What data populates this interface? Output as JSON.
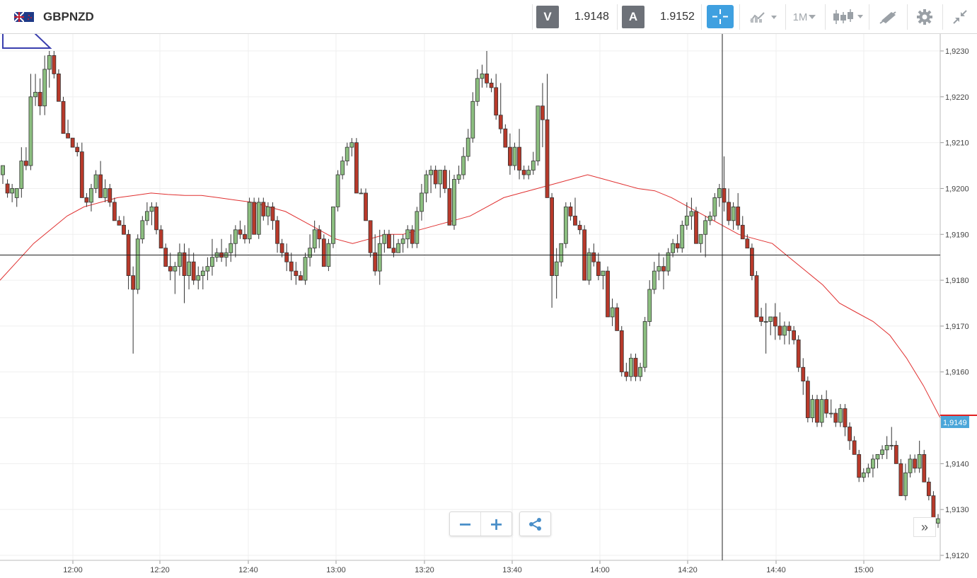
{
  "header": {
    "symbol": "GBPNZD",
    "bid_label": "V",
    "bid_value": "1.9148",
    "ask_label": "A",
    "ask_value": "1.9152",
    "timeframe": "1M",
    "icons": [
      "flag-gbp-nzd-icon",
      "crosshair-icon",
      "chart-type-icon",
      "timeframe-dropdown",
      "candlestick-icon",
      "draw-tool-icon",
      "settings-gear-icon",
      "collapse-arrows-icon"
    ]
  },
  "controls": {
    "zoom_out": "−",
    "zoom_in": "+",
    "share_icon": "share-icon",
    "scroll_right": "»"
  },
  "chart_data": {
    "type": "candlestick",
    "y_ticks": [
      "1,9230",
      "1,9220",
      "1,9210",
      "1,9200",
      "1,9190",
      "1,9180",
      "1,9170",
      "1,9160",
      "1,9150",
      "1,9140",
      "1,9130",
      "1,9120"
    ],
    "x_ticks": [
      "12:00",
      "12:20",
      "12:40",
      "13:00",
      "13:20",
      "13:40",
      "14:00",
      "14:20",
      "14:40",
      "15:00"
    ],
    "ylim": [
      1.9118,
      1.9233
    ],
    "current_price_label": "1,9149",
    "current_price": 1.9149,
    "horizontal_line": 1.91855,
    "moving_average_color": "#e03030",
    "up_color": "#8cbf80",
    "down_color": "#b8392a",
    "moving_average": [
      1.918,
      1.9184,
      1.9188,
      1.9191,
      1.9194,
      1.9196,
      1.9197,
      1.9198,
      1.91985,
      1.9199,
      1.91987,
      1.91985,
      1.91985,
      1.9198,
      1.91975,
      1.9197,
      1.9196,
      1.9195,
      1.9193,
      1.9191,
      1.9189,
      1.9188,
      1.9189,
      1.919,
      1.919,
      1.9191,
      1.9192,
      1.9193,
      1.9194,
      1.9196,
      1.9198,
      1.9199,
      1.92,
      1.9201,
      1.9202,
      1.9203,
      1.9202,
      1.9201,
      1.92,
      1.91995,
      1.9198,
      1.9196,
      1.9194,
      1.9192,
      1.919,
      1.9189,
      1.9188,
      1.9185,
      1.9182,
      1.9179,
      1.9175,
      1.9173,
      1.9171,
      1.9168,
      1.9163,
      1.9157,
      1.915
    ],
    "candles": [
      [
        1.9203,
        1.9205,
        1.9201,
        1.9205
      ],
      [
        1.9201,
        1.9202,
        1.9198,
        1.9199
      ],
      [
        1.9199,
        1.9201,
        1.9197,
        1.92
      ],
      [
        1.9198,
        1.92,
        1.9196,
        1.92
      ],
      [
        1.92,
        1.9209,
        1.9198,
        1.9206
      ],
      [
        1.9206,
        1.9209,
        1.9204,
        1.9205
      ],
      [
        1.9205,
        1.9225,
        1.9204,
        1.922
      ],
      [
        1.922,
        1.9225,
        1.9218,
        1.9221
      ],
      [
        1.9221,
        1.9224,
        1.9216,
        1.9218
      ],
      [
        1.9218,
        1.9229,
        1.9216,
        1.9226
      ],
      [
        1.9226,
        1.923,
        1.9222,
        1.9229
      ],
      [
        1.9229,
        1.923,
        1.9224,
        1.9225
      ],
      [
        1.9225,
        1.9226,
        1.9219,
        1.9219
      ],
      [
        1.9219,
        1.922,
        1.9212,
        1.9212
      ],
      [
        1.9212,
        1.9215,
        1.9211,
        1.9211
      ],
      [
        1.9211,
        1.9211,
        1.9209,
        1.9209
      ],
      [
        1.9209,
        1.921,
        1.9207,
        1.9208
      ],
      [
        1.9208,
        1.921,
        1.9198,
        1.9198
      ],
      [
        1.9198,
        1.9199,
        1.9196,
        1.9197
      ],
      [
        1.9197,
        1.9201,
        1.9195,
        1.92
      ],
      [
        1.92,
        1.9204,
        1.9199,
        1.9203
      ],
      [
        1.9203,
        1.9206,
        1.9198,
        1.9198
      ],
      [
        1.9198,
        1.9202,
        1.9197,
        1.92
      ],
      [
        1.92,
        1.9201,
        1.9196,
        1.9197
      ],
      [
        1.9197,
        1.9198,
        1.9193,
        1.9193
      ],
      [
        1.9193,
        1.9194,
        1.9192,
        1.9192
      ],
      [
        1.9192,
        1.9194,
        1.919,
        1.919
      ],
      [
        1.919,
        1.9191,
        1.9178,
        1.9181
      ],
      [
        1.9181,
        1.9183,
        1.9164,
        1.9178
      ],
      [
        1.9178,
        1.919,
        1.9177,
        1.9189
      ],
      [
        1.9189,
        1.9194,
        1.9188,
        1.9193
      ],
      [
        1.9193,
        1.9197,
        1.9192,
        1.9195
      ],
      [
        1.9195,
        1.9197,
        1.9192,
        1.9196
      ],
      [
        1.9196,
        1.9197,
        1.919,
        1.9191
      ],
      [
        1.9191,
        1.9192,
        1.9187,
        1.9187
      ],
      [
        1.9187,
        1.9188,
        1.9183,
        1.9183
      ],
      [
        1.9183,
        1.9186,
        1.918,
        1.9182
      ],
      [
        1.9182,
        1.9184,
        1.9177,
        1.9183
      ],
      [
        1.9183,
        1.9188,
        1.9181,
        1.9186
      ],
      [
        1.9186,
        1.9188,
        1.9175,
        1.9181
      ],
      [
        1.9181,
        1.9187,
        1.9178,
        1.9184
      ],
      [
        1.9184,
        1.9186,
        1.9179,
        1.918
      ],
      [
        1.918,
        1.9183,
        1.9178,
        1.9181
      ],
      [
        1.9181,
        1.9183,
        1.9178,
        1.9182
      ],
      [
        1.9182,
        1.9185,
        1.918,
        1.9183
      ],
      [
        1.9183,
        1.9189,
        1.9181,
        1.9185
      ],
      [
        1.9185,
        1.9187,
        1.9184,
        1.9186
      ],
      [
        1.9186,
        1.9189,
        1.9184,
        1.9185
      ],
      [
        1.9185,
        1.9187,
        1.9183,
        1.9186
      ],
      [
        1.9186,
        1.919,
        1.9184,
        1.9188
      ],
      [
        1.9188,
        1.9192,
        1.9185,
        1.9191
      ],
      [
        1.9191,
        1.9193,
        1.9189,
        1.919
      ],
      [
        1.919,
        1.9192,
        1.9188,
        1.9189
      ],
      [
        1.9189,
        1.9198,
        1.9188,
        1.9197
      ],
      [
        1.9197,
        1.9198,
        1.919,
        1.919
      ],
      [
        1.919,
        1.9198,
        1.9189,
        1.9197
      ],
      [
        1.9197,
        1.9198,
        1.9193,
        1.9194
      ],
      [
        1.9194,
        1.9197,
        1.9192,
        1.9196
      ],
      [
        1.9196,
        1.9197,
        1.9191,
        1.9193
      ],
      [
        1.9193,
        1.9194,
        1.9186,
        1.9188
      ],
      [
        1.9188,
        1.9189,
        1.9185,
        1.9186
      ],
      [
        1.9186,
        1.9188,
        1.9182,
        1.9184
      ],
      [
        1.9184,
        1.9186,
        1.918,
        1.9182
      ],
      [
        1.9182,
        1.9184,
        1.9179,
        1.9181
      ],
      [
        1.9181,
        1.9182,
        1.918,
        1.918
      ],
      [
        1.918,
        1.9186,
        1.9179,
        1.9185
      ],
      [
        1.9185,
        1.919,
        1.9183,
        1.9187
      ],
      [
        1.9187,
        1.9193,
        1.9186,
        1.9191
      ],
      [
        1.9191,
        1.9192,
        1.9187,
        1.9189
      ],
      [
        1.9189,
        1.919,
        1.9183,
        1.9183
      ],
      [
        1.9183,
        1.9189,
        1.9182,
        1.9188
      ],
      [
        1.9188,
        1.9196,
        1.9187,
        1.9196
      ],
      [
        1.9196,
        1.9204,
        1.9195,
        1.9203
      ],
      [
        1.9203,
        1.9207,
        1.9202,
        1.9206
      ],
      [
        1.9206,
        1.921,
        1.9205,
        1.9209
      ],
      [
        1.9209,
        1.9211,
        1.9207,
        1.921
      ],
      [
        1.921,
        1.9211,
        1.9199,
        1.9199
      ],
      [
        1.9199,
        1.92,
        1.9199,
        1.9199
      ],
      [
        1.9199,
        1.92,
        1.9193,
        1.9193
      ],
      [
        1.9193,
        1.9193,
        1.9185,
        1.9186
      ],
      [
        1.9186,
        1.919,
        1.9181,
        1.9182
      ],
      [
        1.9182,
        1.9191,
        1.9179,
        1.9188
      ],
      [
        1.9188,
        1.9191,
        1.9186,
        1.919
      ],
      [
        1.919,
        1.9191,
        1.9187,
        1.9187
      ],
      [
        1.9187,
        1.919,
        1.9185,
        1.9186
      ],
      [
        1.9186,
        1.9189,
        1.9186,
        1.9188
      ],
      [
        1.9188,
        1.919,
        1.9186,
        1.9189
      ],
      [
        1.9189,
        1.9192,
        1.9187,
        1.9191
      ],
      [
        1.9191,
        1.9192,
        1.9187,
        1.9188
      ],
      [
        1.9188,
        1.9196,
        1.9187,
        1.9195
      ],
      [
        1.9195,
        1.9201,
        1.9193,
        1.9199
      ],
      [
        1.9199,
        1.9204,
        1.9197,
        1.9203
      ],
      [
        1.9203,
        1.9205,
        1.9199,
        1.9204
      ],
      [
        1.9204,
        1.9205,
        1.92,
        1.9201
      ],
      [
        1.9201,
        1.9204,
        1.9198,
        1.9204
      ],
      [
        1.9204,
        1.9205,
        1.9199,
        1.92
      ],
      [
        1.92,
        1.9204,
        1.9192,
        1.9192
      ],
      [
        1.9192,
        1.9203,
        1.9191,
        1.9202
      ],
      [
        1.9202,
        1.9205,
        1.9201,
        1.9203
      ],
      [
        1.9203,
        1.9209,
        1.9202,
        1.9207
      ],
      [
        1.9207,
        1.9213,
        1.9206,
        1.9211
      ],
      [
        1.9211,
        1.9221,
        1.921,
        1.9219
      ],
      [
        1.9219,
        1.9226,
        1.9218,
        1.9224
      ],
      [
        1.9224,
        1.9227,
        1.9222,
        1.9225
      ],
      [
        1.9225,
        1.923,
        1.9222,
        1.9223
      ],
      [
        1.9223,
        1.9224,
        1.9221,
        1.9222
      ],
      [
        1.9222,
        1.9225,
        1.9215,
        1.9216
      ],
      [
        1.9216,
        1.9223,
        1.9212,
        1.9213
      ],
      [
        1.9213,
        1.9214,
        1.9209,
        1.9209
      ],
      [
        1.9209,
        1.9212,
        1.9203,
        1.9205
      ],
      [
        1.9205,
        1.921,
        1.9204,
        1.9209
      ],
      [
        1.9209,
        1.9213,
        1.9202,
        1.9204
      ],
      [
        1.9204,
        1.9205,
        1.9202,
        1.9203
      ],
      [
        1.9203,
        1.9205,
        1.9202,
        1.9204
      ],
      [
        1.9204,
        1.9208,
        1.9203,
        1.9206
      ],
      [
        1.9206,
        1.9218,
        1.9205,
        1.9218
      ],
      [
        1.9218,
        1.9223,
        1.9209,
        1.9215
      ],
      [
        1.9215,
        1.9225,
        1.9198,
        1.9198
      ],
      [
        1.9198,
        1.9199,
        1.9174,
        1.9181
      ],
      [
        1.9181,
        1.9187,
        1.9176,
        1.9184
      ],
      [
        1.9184,
        1.9188,
        1.9183,
        1.9188
      ],
      [
        1.9188,
        1.9197,
        1.9187,
        1.9196
      ],
      [
        1.9196,
        1.9197,
        1.9193,
        1.9194
      ],
      [
        1.9194,
        1.9198,
        1.9192,
        1.9192
      ],
      [
        1.9192,
        1.9193,
        1.919,
        1.9191
      ],
      [
        1.9191,
        1.9192,
        1.918,
        1.918
      ],
      [
        1.918,
        1.9187,
        1.9179,
        1.9186
      ],
      [
        1.9186,
        1.9188,
        1.9183,
        1.9184
      ],
      [
        1.9184,
        1.9186,
        1.918,
        1.9181
      ],
      [
        1.9181,
        1.9182,
        1.9178,
        1.9182
      ],
      [
        1.9182,
        1.9183,
        1.9172,
        1.9172
      ],
      [
        1.9172,
        1.9176,
        1.917,
        1.9174
      ],
      [
        1.9174,
        1.9175,
        1.9169,
        1.9169
      ],
      [
        1.9169,
        1.917,
        1.9159,
        1.916
      ],
      [
        1.916,
        1.9162,
        1.9158,
        1.9159
      ],
      [
        1.9159,
        1.9164,
        1.9158,
        1.9163
      ],
      [
        1.9163,
        1.9164,
        1.9158,
        1.9159
      ],
      [
        1.9159,
        1.9162,
        1.9158,
        1.9161
      ],
      [
        1.9161,
        1.9172,
        1.916,
        1.9171
      ],
      [
        1.9171,
        1.918,
        1.917,
        1.9178
      ],
      [
        1.9178,
        1.9184,
        1.9177,
        1.9182
      ],
      [
        1.9182,
        1.9186,
        1.918,
        1.9183
      ],
      [
        1.9183,
        1.9185,
        1.9178,
        1.9182
      ],
      [
        1.9182,
        1.9187,
        1.9181,
        1.9186
      ],
      [
        1.9186,
        1.9189,
        1.9185,
        1.9188
      ],
      [
        1.9188,
        1.919,
        1.9186,
        1.9187
      ],
      [
        1.9187,
        1.9193,
        1.9186,
        1.9192
      ],
      [
        1.9192,
        1.9197,
        1.9191,
        1.9194
      ],
      [
        1.9194,
        1.9198,
        1.9191,
        1.9195
      ],
      [
        1.9195,
        1.9196,
        1.9188,
        1.9188
      ],
      [
        1.9188,
        1.919,
        1.9186,
        1.919
      ],
      [
        1.919,
        1.9194,
        1.9185,
        1.9193
      ],
      [
        1.9193,
        1.9195,
        1.9192,
        1.9194
      ],
      [
        1.9194,
        1.9199,
        1.9193,
        1.9198
      ],
      [
        1.9198,
        1.9201,
        1.9196,
        1.92
      ],
      [
        1.92,
        1.9207,
        1.9195,
        1.9197
      ],
      [
        1.9197,
        1.92,
        1.9192,
        1.9193
      ],
      [
        1.9193,
        1.9197,
        1.9191,
        1.9196
      ],
      [
        1.9196,
        1.9199,
        1.9191,
        1.9192
      ],
      [
        1.9192,
        1.9194,
        1.9189,
        1.9189
      ],
      [
        1.9189,
        1.919,
        1.9187,
        1.9187
      ],
      [
        1.9187,
        1.9188,
        1.918,
        1.9181
      ],
      [
        1.9181,
        1.9182,
        1.9172,
        1.9172
      ],
      [
        1.9172,
        1.9174,
        1.917,
        1.9171
      ],
      [
        1.9171,
        1.9175,
        1.9164,
        1.9171
      ],
      [
        1.9171,
        1.9172,
        1.9168,
        1.9172
      ],
      [
        1.9172,
        1.9175,
        1.9167,
        1.917
      ],
      [
        1.917,
        1.9173,
        1.9167,
        1.9168
      ],
      [
        1.9168,
        1.9171,
        1.9166,
        1.917
      ],
      [
        1.917,
        1.9171,
        1.9166,
        1.9169
      ],
      [
        1.9169,
        1.917,
        1.9166,
        1.9167
      ],
      [
        1.9167,
        1.9168,
        1.916,
        1.9161
      ],
      [
        1.9161,
        1.9163,
        1.9155,
        1.9158
      ],
      [
        1.9158,
        1.9159,
        1.9149,
        1.915
      ],
      [
        1.915,
        1.9155,
        1.9149,
        1.9154
      ],
      [
        1.9154,
        1.9155,
        1.9148,
        1.9149
      ],
      [
        1.9149,
        1.9155,
        1.9148,
        1.9154
      ],
      [
        1.9154,
        1.9156,
        1.915,
        1.9151
      ],
      [
        1.9151,
        1.9154,
        1.915,
        1.9151
      ],
      [
        1.9151,
        1.9152,
        1.9148,
        1.9149
      ],
      [
        1.9149,
        1.9153,
        1.9148,
        1.9152
      ],
      [
        1.9152,
        1.9153,
        1.9146,
        1.9148
      ],
      [
        1.9148,
        1.9149,
        1.9143,
        1.9145
      ],
      [
        1.9145,
        1.9146,
        1.9142,
        1.9142
      ],
      [
        1.9142,
        1.9143,
        1.9136,
        1.9137
      ],
      [
        1.9137,
        1.9139,
        1.9136,
        1.9138
      ],
      [
        1.9138,
        1.914,
        1.9137,
        1.9139
      ],
      [
        1.9139,
        1.9142,
        1.9137,
        1.9141
      ],
      [
        1.9141,
        1.9142,
        1.9139,
        1.9142
      ],
      [
        1.9142,
        1.9144,
        1.9141,
        1.9143
      ],
      [
        1.9143,
        1.9146,
        1.9141,
        1.9144
      ],
      [
        1.9144,
        1.9148,
        1.9143,
        1.9144
      ],
      [
        1.9144,
        1.9145,
        1.914,
        1.914
      ],
      [
        1.914,
        1.9141,
        1.9133,
        1.9133
      ],
      [
        1.9133,
        1.914,
        1.9132,
        1.9138
      ],
      [
        1.9138,
        1.9142,
        1.9137,
        1.9141
      ],
      [
        1.9141,
        1.9142,
        1.9138,
        1.9139
      ],
      [
        1.9139,
        1.9145,
        1.9138,
        1.9142
      ],
      [
        1.9142,
        1.9143,
        1.9136,
        1.9136
      ],
      [
        1.9136,
        1.9137,
        1.9132,
        1.9133
      ],
      [
        1.9133,
        1.9134,
        1.9126,
        1.9127
      ],
      [
        1.9127,
        1.9129,
        1.9126,
        1.9128
      ]
    ]
  }
}
